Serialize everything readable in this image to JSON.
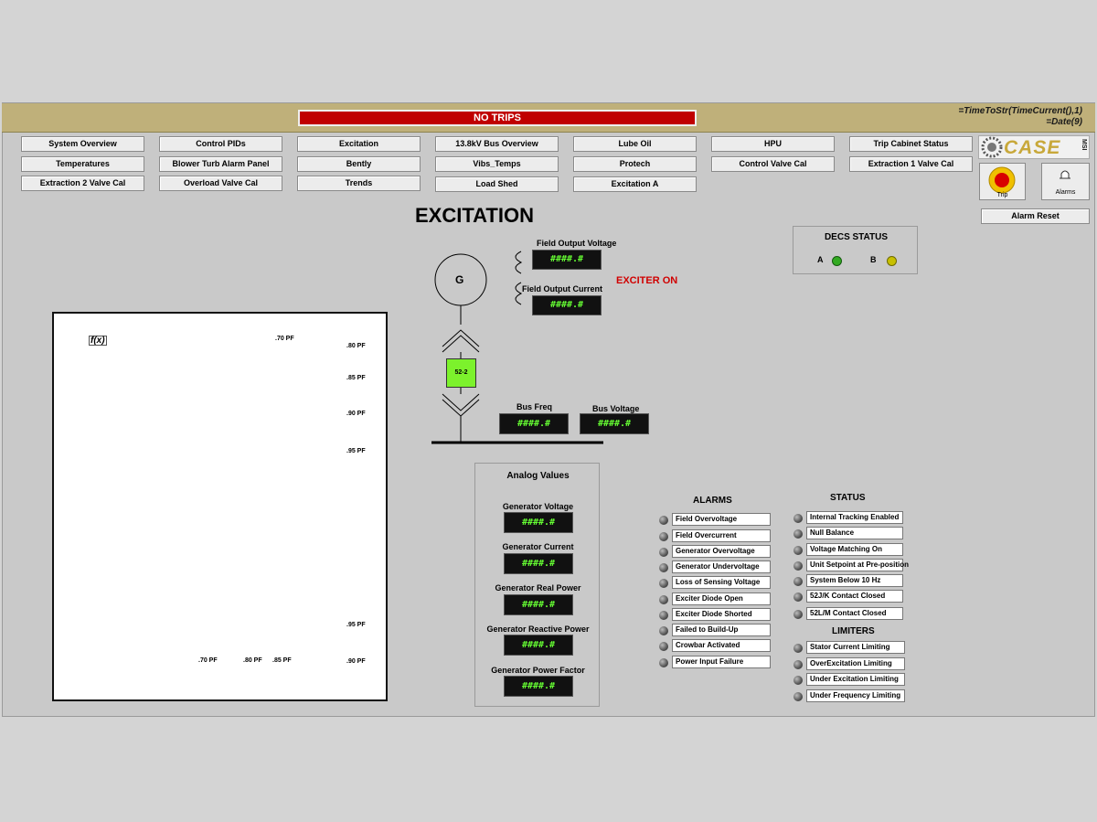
{
  "header": {
    "trip_banner": "NO TRIPS",
    "time_line1": "=TimeToStr(TimeCurrent(),1)",
    "time_line2": "=Date(9)"
  },
  "nav": {
    "row1": [
      "System Overview",
      "Control PIDs",
      "Excitation",
      "13.8kV Bus Overview",
      "Lube Oil",
      "HPU",
      "Trip Cabinet Status"
    ],
    "row2": [
      "Temperatures",
      "Blower Turb Alarm Panel",
      "Bently",
      "Vibs_Temps",
      "Protech",
      "Control Valve Cal",
      "Extraction 1 Valve Cal"
    ],
    "row3": [
      "Extraction 2 Valve Cal",
      "Overload Valve Cal",
      "Trends",
      "Load Shed",
      "Excitation A"
    ]
  },
  "logo": {
    "text": "CASE",
    "subtext": "MSI"
  },
  "controls": {
    "trip_label": "Trip",
    "alarms_label": "Alarms",
    "alarm_reset": "Alarm Reset"
  },
  "page_title": "EXCITATION",
  "decs": {
    "title": "DECS STATUS",
    "a_label": "A",
    "b_label": "B",
    "a_color": "#33aa22",
    "b_color": "#c8c000"
  },
  "generator": {
    "symbol": "G",
    "field_voltage_label": "Field Output Voltage",
    "field_voltage_value": "####.#",
    "field_current_label": "Field Output Current",
    "field_current_value": "####.#",
    "exciter_status": "EXCITER ON",
    "breaker_label": "52-2",
    "bus_freq_label": "Bus Freq",
    "bus_freq_value": "####.#",
    "bus_voltage_label": "Bus Voltage",
    "bus_voltage_value": "####.#"
  },
  "capability_chart": {
    "corner_label": "f(x)",
    "pf_labels_right": [
      ".80 PF",
      ".85 PF",
      ".90 PF",
      ".95 PF",
      ".95 PF",
      ".90 PF"
    ],
    "pf_top": ".70 PF",
    "pf_bottom": [
      ".70 PF",
      ".80 PF",
      ".85 PF"
    ]
  },
  "analog": {
    "title": "Analog Values",
    "items": [
      {
        "label": "Generator Voltage",
        "value": "####.#"
      },
      {
        "label": "Generator Current",
        "value": "####.#"
      },
      {
        "label": "Generator Real Power",
        "value": "####.#"
      },
      {
        "label": "Generator Reactive Power",
        "value": "####.#"
      },
      {
        "label": "Generator Power Factor",
        "value": "####.#"
      }
    ]
  },
  "alarms": {
    "title": "ALARMS",
    "items": [
      "Field Overvoltage",
      "Field Overcurrent",
      "Generator Overvoltage",
      "Generator Undervoltage",
      "Loss of Sensing Voltage",
      "Exciter Diode Open",
      "Exciter Diode Shorted",
      "Failed to Build-Up",
      "Crowbar Activated",
      "Power Input Failure"
    ]
  },
  "status": {
    "title": "STATUS",
    "items": [
      "Internal Tracking Enabled",
      "Null Balance",
      "Voltage Matching On",
      "Unit Setpoint at Pre-position",
      "System Below 10 Hz",
      "52J/K Contact Closed",
      "52L/M Contact Closed"
    ]
  },
  "limiters": {
    "title": "LIMITERS",
    "items": [
      "Stator Current Limiting",
      "OverExcitation Limiting",
      "Under Excitation Limiting",
      "Under Frequency Limiting"
    ]
  }
}
